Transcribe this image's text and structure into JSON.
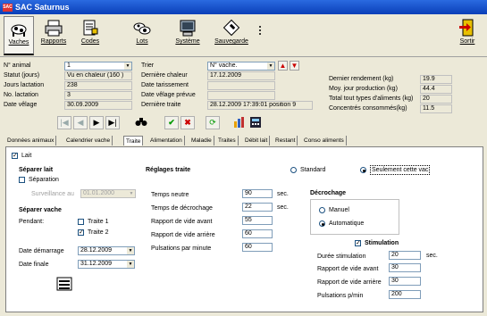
{
  "window_title": "SAC Saturnus",
  "app_icon": "SAC",
  "toolbar": {
    "vaches": "Vaches",
    "rapports": "Rapports",
    "codes": "Codes",
    "lots": "Lots",
    "systeme": "Système",
    "sauvegarde": "Sauvegarde",
    "sortir": "Sortir"
  },
  "info": {
    "n_animal_label": "N° animal",
    "n_animal_value": "1",
    "statut_label": "Statut (jours)",
    "statut_value": "Vu en chaleur (160 )",
    "jours_lact_label": "Jours lactation",
    "jours_lact_value": "238",
    "no_lact_label": "No. lactation",
    "no_lact_value": "3",
    "date_velage_label": "Date vêlage",
    "date_velage_value": "30.09.2009",
    "trier_label": "Trier",
    "trier_value": "N° vache.",
    "derniere_chaleur_label": "Dernière chaleur",
    "derniere_chaleur_value": "17.12.2009",
    "date_tarissement_label": "Date tarissement",
    "date_tarissement_value": "",
    "date_velage_prevue_label": "Date vêlage prévue",
    "date_velage_prevue_value": "",
    "derniere_traite_label": "Dernière traite",
    "derniere_traite_value": "28.12.2009 17:39:01  position 9",
    "dernier_rendement_label": "Dernier rendement (kg)",
    "dernier_rendement_value": "19.9",
    "moy_jour_label": "Moy. jour production (kg)",
    "moy_jour_value": "44.4",
    "total_types_label": "Total tout types d'aliments (kg)",
    "total_types_value": "20",
    "concentres_label": "Concentrés consommés(kg)",
    "concentres_value": "11.5"
  },
  "tabs": [
    "Données animaux",
    "Calendrier vache",
    "Traite",
    "Alimentation",
    "Maladie",
    "Traites",
    "Débit lait",
    "Restant",
    "Conso aliments"
  ],
  "active_tab": "Traite",
  "traite": {
    "lait_label": "Lait",
    "separer_lait_title": "Séparer lait",
    "separation_label": "Séparation",
    "surveillance_label": "Surveillance au",
    "surveillance_value": "01.01.2000",
    "separer_vache_title": "Séparer vache",
    "pendant_label": "Pendant:",
    "traite1_label": "Traite 1",
    "traite2_label": "Traite 2",
    "date_demarrage_label": "Date démarrage",
    "date_demarrage_value": "28.12.2009",
    "date_finale_label": "Date finale",
    "date_finale_value": "31.12.2009",
    "reglages_title": "Réglages traite",
    "standard_label": "Standard",
    "seulement_label": "Seulement cette vac",
    "temps_neutre_label": "Temps neutre",
    "temps_neutre_value": "90",
    "temps_decrochage_label": "Temps de décrochage",
    "temps_decrochage_value": "22",
    "rapport_avant_label": "Rapport de vide avant",
    "rapport_avant_value": "55",
    "rapport_arriere_label": "Rapport de vide arrière",
    "rapport_arriere_value": "60",
    "pulsations_label": "Pulsations par minute",
    "pulsations_value": "60",
    "sec_unit": "sec.",
    "decrochage_title": "Décrochage",
    "manuel_label": "Manuel",
    "automatique_label": "Automatique",
    "stimulation_title": "Stimulation",
    "duree_stim_label": "Durée stimulation",
    "duree_stim_value": "20",
    "stim_avant_label": "Rapport de vide avant",
    "stim_avant_value": "30",
    "stim_arriere_label": "Rapport de vide arrière",
    "stim_arriere_value": "30",
    "pulsations_pmin_label": "Pulsations p/min",
    "pulsations_pmin_value": "200"
  }
}
